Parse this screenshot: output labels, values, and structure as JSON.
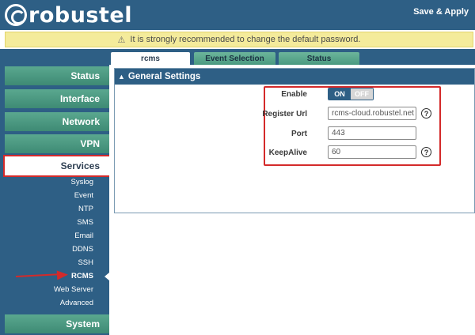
{
  "header": {
    "logo_text": "robustel",
    "save_apply": "Save & Apply"
  },
  "warning": {
    "icon": "warning-triangle-icon",
    "text": "It is strongly recommended to change the default password."
  },
  "sidebar": {
    "menus": {
      "status": "Status",
      "interface": "Interface",
      "network": "Network",
      "vpn": "VPN",
      "services": "Services",
      "system": "System"
    },
    "services_items": [
      "Syslog",
      "Event",
      "NTP",
      "SMS",
      "Email",
      "DDNS",
      "SSH",
      "RCMS",
      "Web Server",
      "Advanced"
    ],
    "current_item": "RCMS"
  },
  "tabs": [
    "rcms",
    "Event Selection",
    "Status"
  ],
  "active_tab": "rcms",
  "panel": {
    "title": "General Settings",
    "fields": {
      "enable_label": "Enable",
      "toggle_on": "ON",
      "toggle_off": "OFF",
      "register_url_label": "Register Url",
      "register_url_value": "rcms-cloud.robustel.net",
      "port_label": "Port",
      "port_value": "443",
      "keepalive_label": "KeepAlive",
      "keepalive_value": "60"
    }
  },
  "colors": {
    "nav_blue": "#2e5f85",
    "menu_green": "#4a9a80",
    "highlight_red": "#d42a2a",
    "warning_yellow": "#f4eb9b"
  }
}
